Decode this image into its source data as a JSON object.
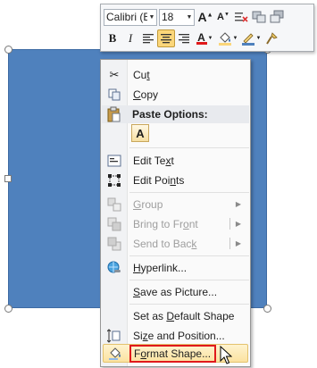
{
  "mini_toolbar": {
    "font_name": "Calibri (E",
    "font_size": "18",
    "grow_font_glyph": "A",
    "shrink_font_glyph": "A",
    "bold_glyph": "B",
    "italic_glyph": "I",
    "font_color_glyph": "A",
    "accent_red": "#e0191b",
    "highlight_yellow": "#fbd67a"
  },
  "menu": {
    "cut": {
      "pre": "Cu",
      "key": "t",
      "post": ""
    },
    "copy": {
      "pre": "",
      "key": "C",
      "post": "opy"
    },
    "paste_options": "Paste Options:",
    "paste_keep_text_only": "A",
    "edit_text": {
      "pre": "Edit Te",
      "key": "x",
      "post": "t"
    },
    "edit_points": {
      "pre": "Edit Poi",
      "key": "n",
      "post": "ts"
    },
    "group": {
      "pre": "",
      "key": "G",
      "post": "roup"
    },
    "bring_to_front": {
      "pre": "Bring to Fr",
      "key": "o",
      "post": "nt"
    },
    "send_to_back": {
      "pre": "Send to Bac",
      "key": "k",
      "post": ""
    },
    "hyperlink": {
      "pre": "",
      "key": "H",
      "post": "yperlink..."
    },
    "save_as_picture": {
      "pre": "",
      "key": "S",
      "post": "ave as Picture..."
    },
    "set_default_shape": {
      "pre": "Set as ",
      "key": "D",
      "post": "efault Shape"
    },
    "size_and_position": {
      "pre": "Si",
      "key": "z",
      "post": "e and Position..."
    },
    "format_shape": {
      "pre": "F",
      "key": "o",
      "post": "rmat Shape..."
    }
  },
  "shape": {
    "fill_color": "#4f81bd"
  }
}
